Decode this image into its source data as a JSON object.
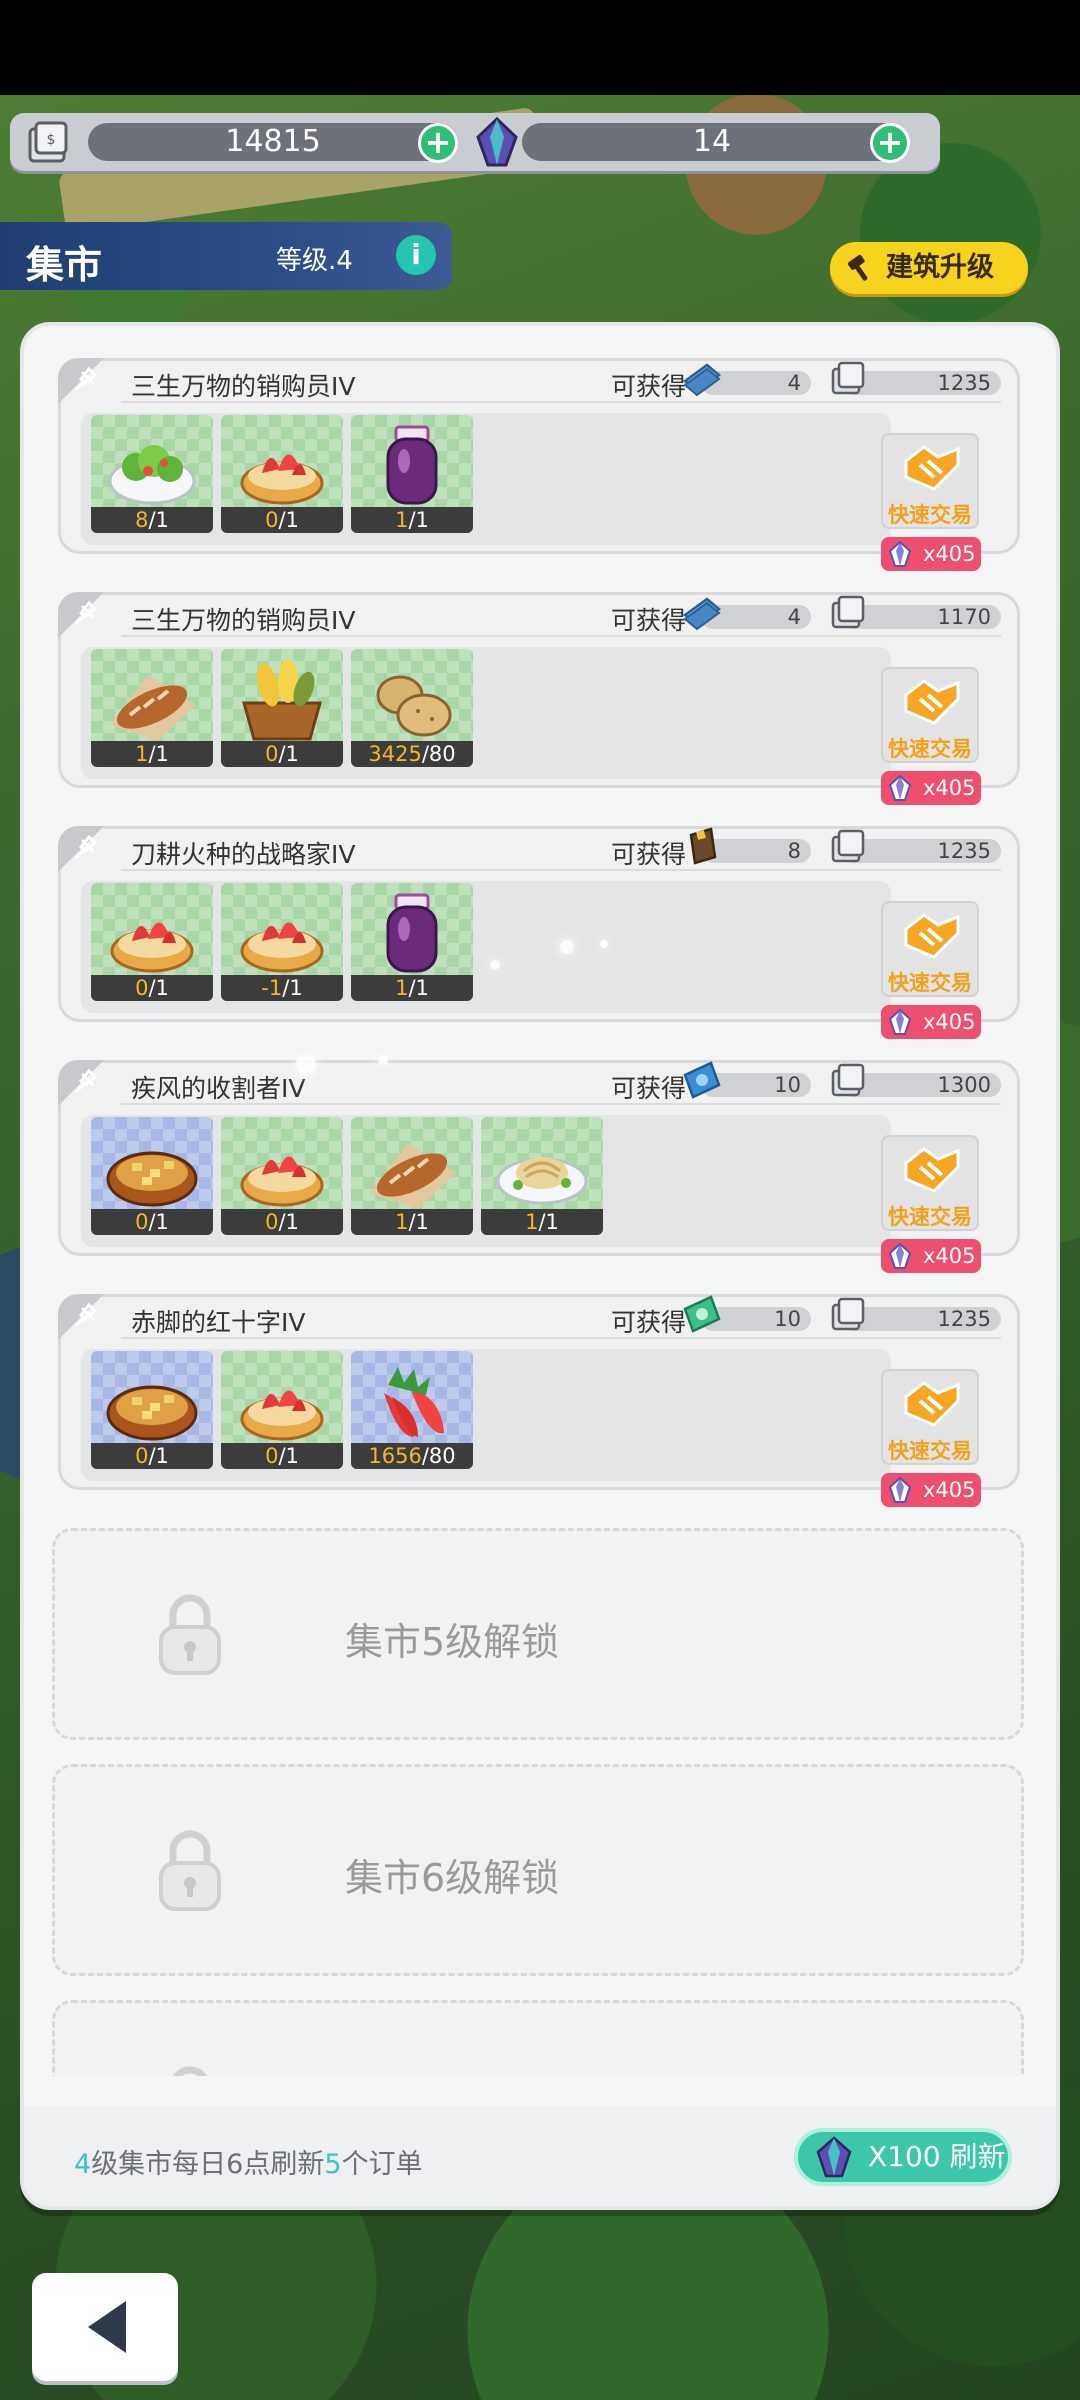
{
  "currency": {
    "coins": "14815",
    "gems": "14"
  },
  "header": {
    "title": "集市",
    "level": "等级.4",
    "upgrade_label": "建筑升级"
  },
  "orders": [
    {
      "name": "三生万物的销购员IV",
      "obtain_label": "可获得",
      "reward_icon": "blueprint-icon",
      "reward_amount": "4",
      "coin_amount": "1235",
      "items": [
        {
          "icon": "salad-icon",
          "have": "8",
          "need": "/1"
        },
        {
          "icon": "strawberry-tart-icon",
          "have": "0",
          "need": "/1"
        },
        {
          "icon": "jam-jar-icon",
          "have": "1",
          "need": "/1"
        }
      ],
      "quick_label": "快速交易",
      "cost": "x405"
    },
    {
      "name": "三生万物的销购员IV",
      "obtain_label": "可获得",
      "reward_icon": "blueprint-icon",
      "reward_amount": "4",
      "coin_amount": "1170",
      "items": [
        {
          "icon": "bread-icon",
          "have": "1",
          "need": "/1"
        },
        {
          "icon": "corn-basket-icon",
          "have": "0",
          "need": "/1"
        },
        {
          "icon": "potato-icon",
          "have": "3425",
          "need": "/80"
        }
      ],
      "quick_label": "快速交易",
      "cost": "x405"
    },
    {
      "name": "刀耕火种的战略家IV",
      "obtain_label": "可获得",
      "reward_icon": "book-icon",
      "reward_amount": "8",
      "coin_amount": "1235",
      "items": [
        {
          "icon": "strawberry-tart-icon",
          "have": "0",
          "need": "/1"
        },
        {
          "icon": "strawberry-tart-icon",
          "have": "-1",
          "need": "/1"
        },
        {
          "icon": "jam-jar-icon",
          "have": "1",
          "need": "/1"
        }
      ],
      "quick_label": "快速交易",
      "cost": "x405"
    },
    {
      "name": "疾风的收割者IV",
      "obtain_label": "可获得",
      "reward_icon": "blue-ticket-icon",
      "reward_amount": "10",
      "coin_amount": "1300",
      "items": [
        {
          "icon": "pie-icon",
          "have": "0",
          "need": "/1"
        },
        {
          "icon": "strawberry-tart-icon",
          "have": "0",
          "need": "/1"
        },
        {
          "icon": "bread-icon",
          "have": "1",
          "need": "/1"
        },
        {
          "icon": "pasta-icon",
          "have": "1",
          "need": "/1"
        }
      ],
      "quick_label": "快速交易",
      "cost": "x405"
    },
    {
      "name": "赤脚的红十字IV",
      "obtain_label": "可获得",
      "reward_icon": "green-ticket-icon",
      "reward_amount": "10",
      "coin_amount": "1235",
      "items": [
        {
          "icon": "pie-icon",
          "have": "0",
          "need": "/1"
        },
        {
          "icon": "strawberry-tart-icon",
          "have": "0",
          "need": "/1"
        },
        {
          "icon": "strawberries-icon",
          "have": "1656",
          "need": "/80"
        }
      ],
      "quick_label": "快速交易",
      "cost": "x405"
    }
  ],
  "locked": [
    {
      "label": "集市5级解锁"
    },
    {
      "label": "集市6级解锁"
    }
  ],
  "footer": {
    "level_num": "4",
    "text_a": "级集市每日6点刷新",
    "orders_num": "5",
    "text_b": "个订单",
    "refresh_label": "X100 刷新"
  },
  "colors": {
    "accent": "#36c7c2",
    "quick_label": "#f1a21c",
    "cost_bg": "#ee4f6e",
    "upgrade_bg": "#f7d21e"
  }
}
